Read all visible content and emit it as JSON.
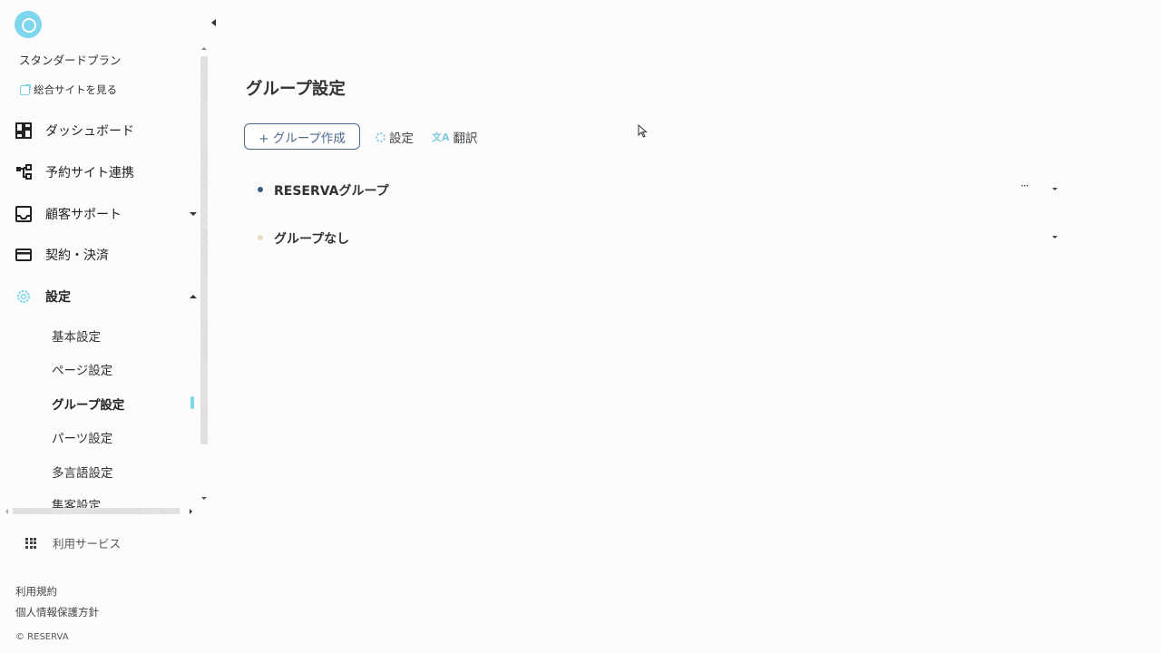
{
  "sidebar": {
    "plan": "スタンダードプラン",
    "site_link": "総合サイトを見る",
    "nav": [
      {
        "label": "ダッシュボード",
        "icon": "dashboard-icon"
      },
      {
        "label": "予約サイト連携",
        "icon": "sitemap-icon"
      },
      {
        "label": "顧客サポート",
        "icon": "inbox-icon"
      },
      {
        "label": "契約・決済",
        "icon": "credit-card-icon"
      },
      {
        "label": "設定",
        "icon": "gear-icon"
      }
    ],
    "sub_items": [
      "基本設定",
      "ページ設定",
      "グループ設定",
      "パーツ設定",
      "多言語設定",
      "集客設定"
    ],
    "services": "利用サービス",
    "footer": {
      "terms": "利用規約",
      "privacy": "個人情報保護方針",
      "copyright": "© RESERVA"
    }
  },
  "main": {
    "title": "グループ設定",
    "create_button": "+ グループ作成",
    "settings_link": "設定",
    "translate_link": "翻訳",
    "translate_glyph": "文A",
    "more_glyph": "···",
    "groups": [
      {
        "name": "RESERVAグループ",
        "color": "#3b5a86",
        "has_more": true
      },
      {
        "name": "グループなし",
        "color": "#e8dcc4",
        "has_more": false
      }
    ]
  },
  "colors": {
    "accent": "#7fd6ee",
    "button_border": "#4a6a8c"
  }
}
